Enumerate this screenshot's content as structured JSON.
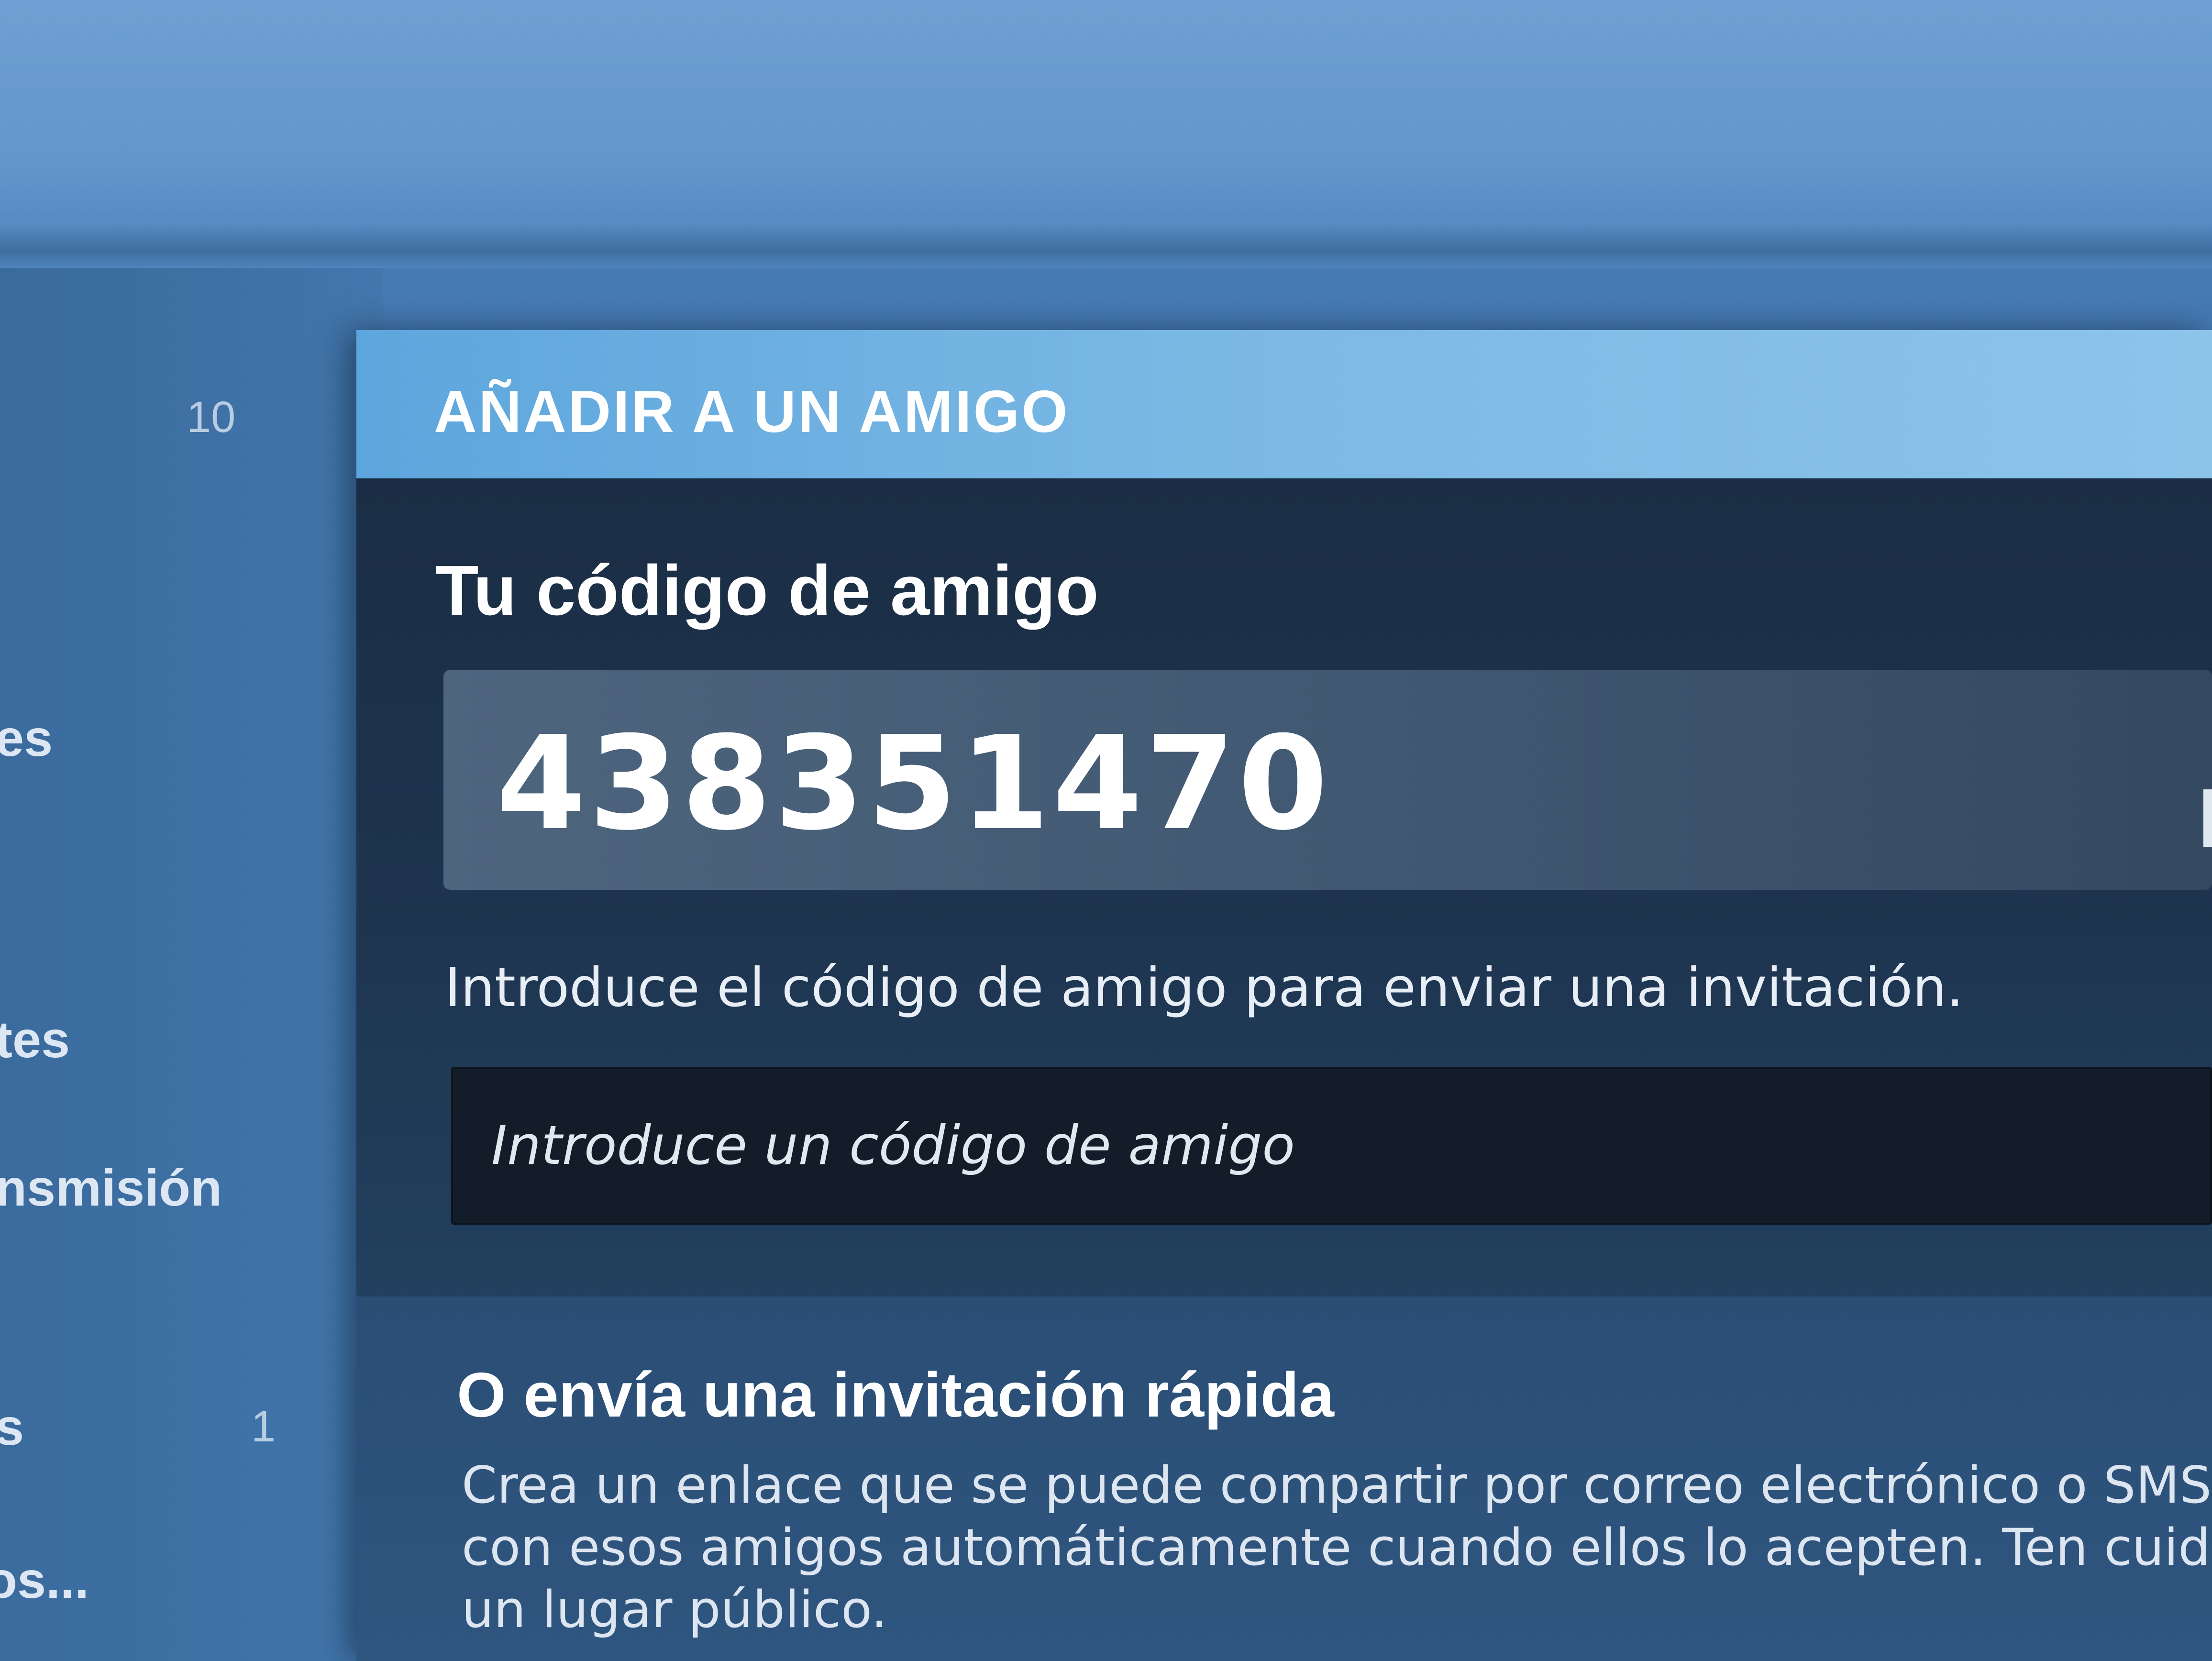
{
  "sidebar": {
    "items": [
      {
        "label": "",
        "count": "10"
      },
      {
        "label": "es",
        "count": ""
      },
      {
        "label": "tes",
        "count": ""
      },
      {
        "label": "nsmisión",
        "count": ""
      },
      {
        "label": "s",
        "count": "1"
      },
      {
        "label": "os...",
        "count": ""
      }
    ]
  },
  "dialog": {
    "title": "AÑADIR A UN AMIGO",
    "code_heading": "Tu código de amigo",
    "friend_code": "438351470",
    "instructions": "Introduce el código de amigo para enviar una invitación.",
    "input_placeholder": "Introduce un código de amigo",
    "quick_heading": "O envía una invitación rápida",
    "quick_lines": [
      "Crea un enlace que se puede compartir por correo electrónico o SMS. Que",
      "con esos amigos automáticamente cuando ellos lo acepten. Ten cuidado a",
      "un lugar público."
    ]
  },
  "colors": {
    "header_accent": "#7ab8e4",
    "dialog_background": "#1f3650",
    "input_background": "#131d29"
  }
}
